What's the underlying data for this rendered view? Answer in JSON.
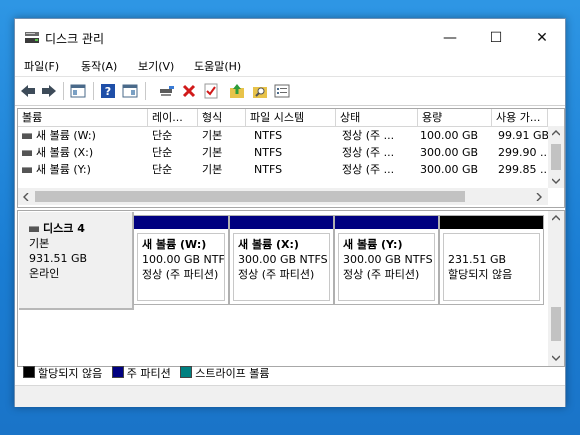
{
  "window": {
    "title": "디스크 관리",
    "minimize": "—",
    "maximize": "☐",
    "close": "✕"
  },
  "menu": [
    "파일(F)",
    "동작(A)",
    "보기(V)",
    "도움말(H)"
  ],
  "colors": {
    "unallocated": "#000000",
    "primary": "#000080",
    "striped": "#008080",
    "desktop": "#1b82d6"
  },
  "table": {
    "headers": [
      "볼륨",
      "레이...",
      "형식",
      "파일 시스템",
      "상태",
      "용량",
      "사용 가..."
    ],
    "rows": [
      [
        "새 볼륨 (W:)",
        "단순",
        "기본",
        "NTFS",
        "정상 (주 ...",
        "100.00 GB",
        "99.91 GB"
      ],
      [
        "새 볼륨 (X:)",
        "단순",
        "기본",
        "NTFS",
        "정상 (주 ...",
        "300.00 GB",
        "299.90 ..."
      ],
      [
        "새 볼륨 (Y:)",
        "단순",
        "기본",
        "NTFS",
        "정상 (주 ...",
        "300.00 GB",
        "299.85 ..."
      ]
    ]
  },
  "disk": {
    "name": "디스크 4",
    "type": "기본",
    "size": "931.51 GB",
    "status": "온라인",
    "partitions": [
      {
        "name": "새 볼륨  (W:)",
        "size": "100.00 GB NTFS",
        "status": "정상 (주 파티션)"
      },
      {
        "name": "새 볼륨  (X:)",
        "size": "300.00 GB NTFS",
        "status": "정상 (주 파티션)"
      },
      {
        "name": "새 볼륨  (Y:)",
        "size": "300.00 GB NTFS",
        "status": "정상 (주 파티션)"
      },
      {
        "name": "",
        "size": "231.51 GB",
        "status": "할당되지 않음"
      }
    ]
  },
  "legend": [
    "할당되지 않음",
    "주 파티션",
    "스트라이프 볼륨"
  ]
}
